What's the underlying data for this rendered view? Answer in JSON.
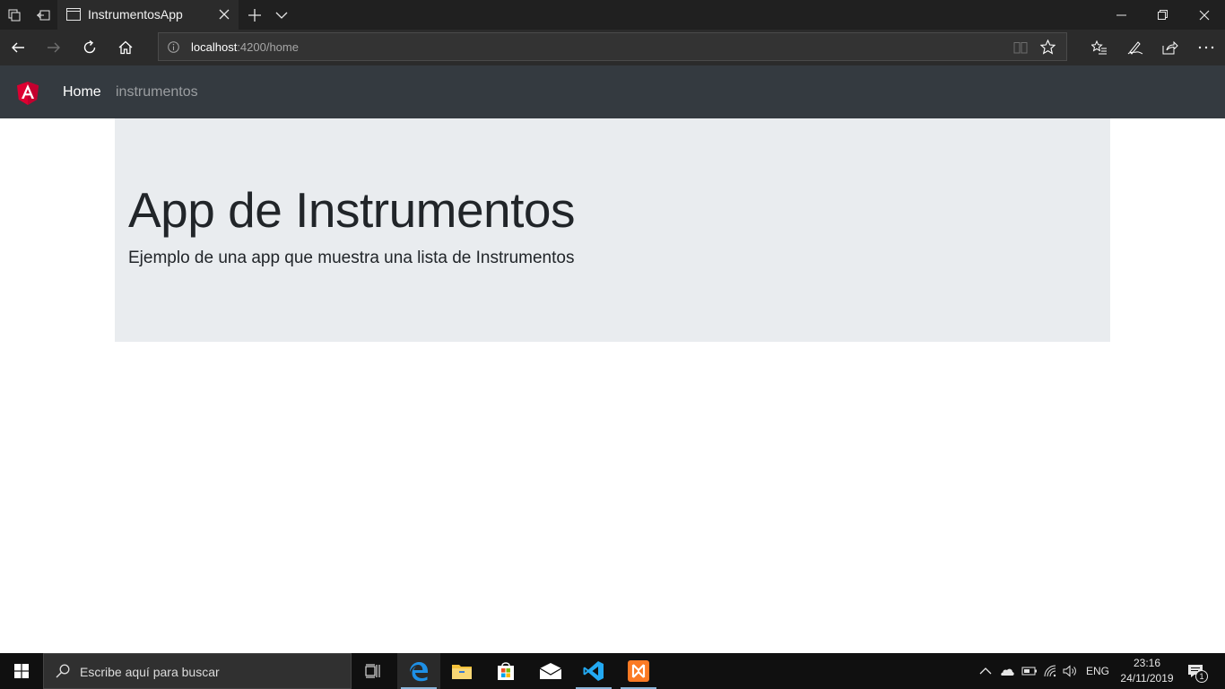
{
  "browser": {
    "tab_title": "InstrumentosApp",
    "url_host": "localhost",
    "url_path": ":4200/home"
  },
  "app": {
    "nav": {
      "home_label": "Home",
      "instruments_label": "instrumentos"
    },
    "jumbotron": {
      "title": "App de Instrumentos",
      "lead": "Ejemplo de una app que muestra una lista de Instrumentos"
    }
  },
  "taskbar": {
    "search_placeholder": "Escribe aquí para buscar",
    "language": "ENG",
    "time": "23:16",
    "date": "24/11/2019",
    "notification_count": "1"
  },
  "colors": {
    "app_navbar": "#343a40",
    "jumbotron": "#e9ecef",
    "angular_red": "#dd0031"
  }
}
